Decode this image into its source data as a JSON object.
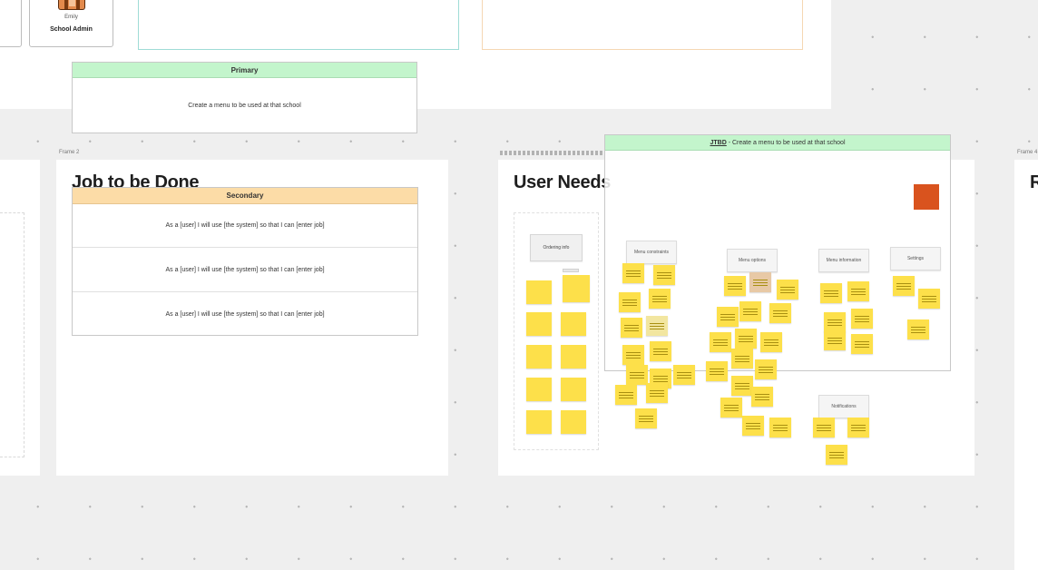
{
  "top": {
    "profile": {
      "name": "Emily",
      "role": "School Admin"
    },
    "primary_card": {
      "header": "Primary",
      "body": "Create a menu to be used at that school"
    }
  },
  "frame_jtbd": {
    "label": "Frame 2",
    "title": "Job to be Done",
    "secondary": {
      "header": "Secondary",
      "rows": [
        "As a [user] I will use [the system] so that I can [enter job]",
        "As a [user] I will use [the system] so that I can [enter job]",
        "As a [user] I will use [the system] so that I can [enter job]"
      ]
    }
  },
  "frame_user_needs": {
    "title": "User Needs",
    "overlay_header_bold": "JTBD",
    "overlay_header_rest": " - Create a menu to be used at that school",
    "clusters": [
      "Ordering info",
      "Menu constraints",
      "Menu options",
      "Menu information",
      "Settings",
      "Notifications"
    ]
  },
  "right_frame": {
    "label": "Frame 4",
    "title_initial": "R"
  },
  "colors": {
    "primary_header": "#c3f5cc",
    "secondary_header": "#fcdca7",
    "sticky": "#fde04a",
    "accent_orange": "#d9531e"
  }
}
